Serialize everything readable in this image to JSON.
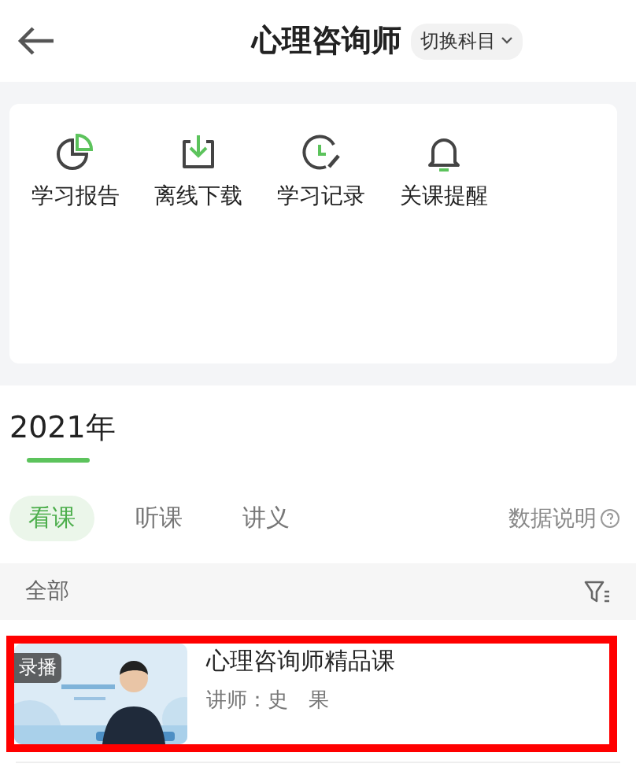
{
  "header": {
    "title": "心理咨询师",
    "switch_label": "切换科目"
  },
  "shortcuts": [
    {
      "kind": "report",
      "label": "学习报告"
    },
    {
      "kind": "download",
      "label": "离线下载"
    },
    {
      "kind": "record",
      "label": "学习记录"
    },
    {
      "kind": "reminder",
      "label": "关课提醒"
    }
  ],
  "year": "2021年",
  "tabs": [
    {
      "label": "看课",
      "selected": true
    },
    {
      "label": "听课",
      "selected": false
    },
    {
      "label": "讲义",
      "selected": false
    }
  ],
  "data_note": "数据说明",
  "filter": {
    "label": "全部"
  },
  "courses": [
    {
      "badge": "录播",
      "title": "心理咨询师精品课",
      "teacher": "讲师：史　果",
      "highlighted": true
    }
  ]
}
